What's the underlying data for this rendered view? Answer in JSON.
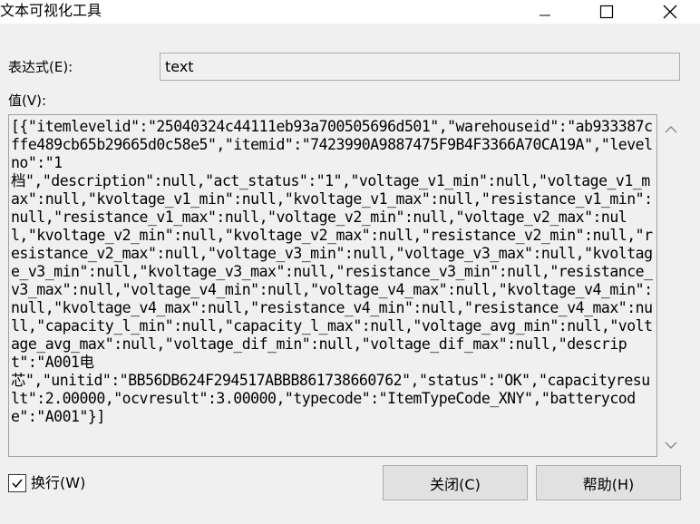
{
  "window": {
    "title": "文本可视化工具",
    "controls": {
      "minimize_icon": "minimize-icon",
      "maximize_icon": "maximize-icon",
      "close_icon": "close-icon"
    }
  },
  "expression": {
    "label": "表达式(E):",
    "value": "text"
  },
  "value_field": {
    "label": "值(V):",
    "text": "[{\"itemlevelid\":\"25040324c44111eb93a700505696d501\",\"warehouseid\":\"ab933387cffe489cb65b29665d0c58e5\",\"itemid\":\"7423990A9887475F9B4F3366A70CA19A\",\"levelno\":\"1\n档\",\"description\":null,\"act_status\":\"1\",\"voltage_v1_min\":null,\"voltage_v1_max\":null,\"kvoltage_v1_min\":null,\"kvoltage_v1_max\":null,\"resistance_v1_min\":null,\"resistance_v1_max\":null,\"voltage_v2_min\":null,\"voltage_v2_max\":null,\"kvoltage_v2_min\":null,\"kvoltage_v2_max\":null,\"resistance_v2_min\":null,\"resistance_v2_max\":null,\"voltage_v3_min\":null,\"voltage_v3_max\":null,\"kvoltage_v3_min\":null,\"kvoltage_v3_max\":null,\"resistance_v3_min\":null,\"resistance_v3_max\":null,\"voltage_v4_min\":null,\"voltage_v4_max\":null,\"kvoltage_v4_min\":null,\"kvoltage_v4_max\":null,\"resistance_v4_min\":null,\"resistance_v4_max\":null,\"capacity_l_min\":null,\"capacity_l_max\":null,\"voltage_avg_min\":null,\"voltage_avg_max\":null,\"voltage_dif_min\":null,\"voltage_dif_max\":null,\"descript\":\"A001电\n芯\",\"unitid\":\"BB56DB624F294517ABBB861738660762\",\"status\":\"OK\",\"capacityresult\":2.00000,\"ocvresult\":3.00000,\"typecode\":\"ItemTypeCode_XNY\",\"batterycode\":\"A001\"}]",
    "scroll_up_icon": "chevron-up-icon",
    "scroll_down_icon": "chevron-down-icon"
  },
  "word_wrap": {
    "label": "换行(W)",
    "checked": true
  },
  "buttons": {
    "close_label": "关闭(C)",
    "help_label": "帮助(H)"
  }
}
